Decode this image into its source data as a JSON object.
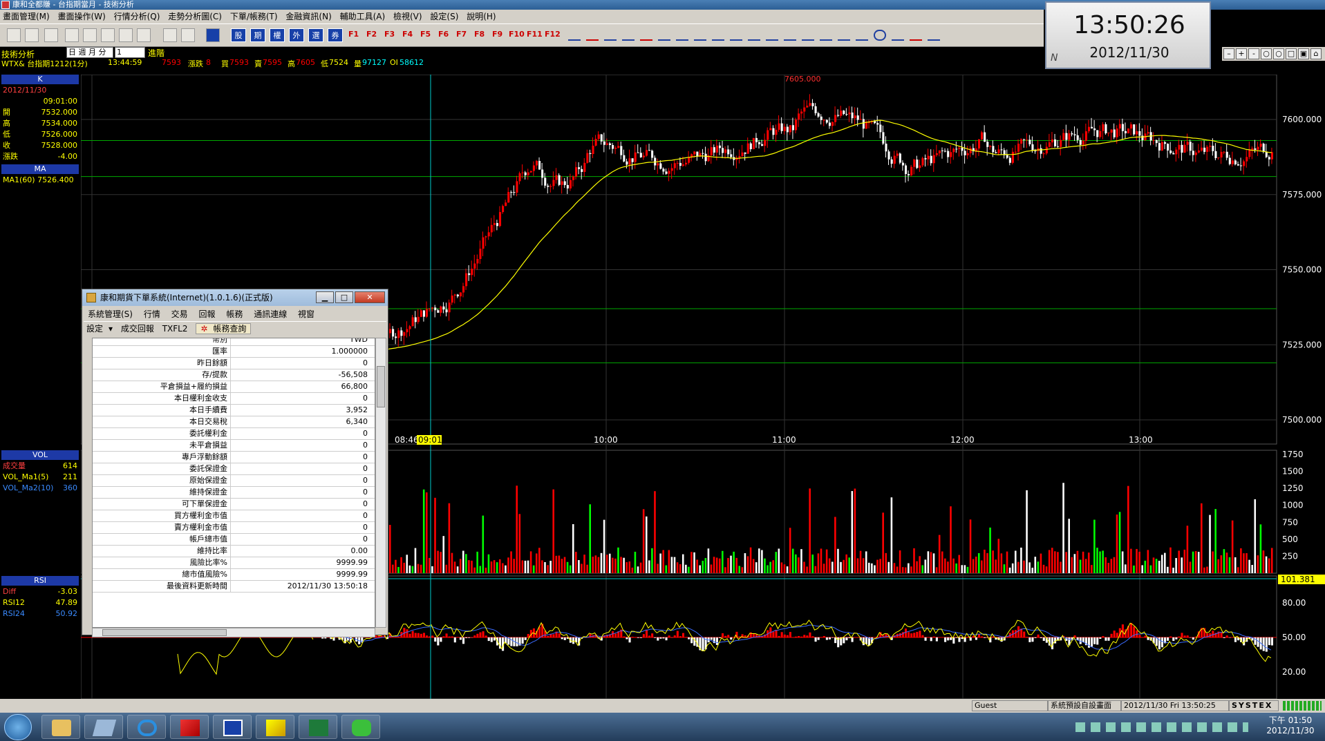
{
  "window": {
    "title": "康和全都賺 - 台指期當月 - 技術分析"
  },
  "menu": {
    "items": [
      "畫面管理(M)",
      "畫面操作(W)",
      "行情分析(Q)",
      "走勢分析圖(C)",
      "下單/帳務(T)",
      "金融資訊(N)",
      "輔助工具(A)",
      "檢視(V)",
      "設定(S)",
      "說明(H)"
    ]
  },
  "toolbar": {
    "red_buttons": [
      "股",
      "期",
      "權",
      "外",
      "選",
      "券"
    ],
    "fkeys": [
      "F1",
      "F2",
      "F3",
      "F4",
      "F5",
      "F6",
      "F7",
      "F8",
      "F9",
      "F10",
      "F11",
      "F12"
    ]
  },
  "clock": {
    "time": "13:50:26",
    "date": "2012/11/30",
    "badge": "N"
  },
  "info": {
    "title": "技術分析",
    "freq_label": "日 週 月 分",
    "freq_value": "1",
    "advance": "進階",
    "symbol": "WTX& 台指期1212(1分)",
    "time": "13:44:59",
    "last": "7593",
    "change_label": "漲跌",
    "change": "8",
    "bid_label": "買",
    "bid": "7593",
    "ask_label": "賣",
    "ask": "7595",
    "high_label": "高",
    "high": "7605",
    "low_label": "低",
    "low": "7524",
    "vol_label": "量",
    "vol": "97127",
    "oi_label": "OI",
    "oi": "58612"
  },
  "leftpanel": {
    "k_header": "K",
    "date": "2012/11/30",
    "time": "09:01:00",
    "rows": [
      {
        "k": "開",
        "v": "7532.000"
      },
      {
        "k": "高",
        "v": "7534.000"
      },
      {
        "k": "低",
        "v": "7526.000"
      },
      {
        "k": "收",
        "v": "7528.000"
      },
      {
        "k": "漲跌",
        "v": "-4.00"
      }
    ],
    "ma_header": "MA",
    "ma_row": "MA1(60) 7526.400",
    "vol_header": "VOL",
    "vol_rows": [
      {
        "k": "成交量",
        "v": "614"
      },
      {
        "k": "VOL_Ma1(5)",
        "v": "211"
      },
      {
        "k": "VOL_Ma2(10)",
        "v": "360"
      }
    ],
    "rsi_header": "RSI",
    "rsi_rows": [
      {
        "k": "Diff",
        "v": "-3.03"
      },
      {
        "k": "RSI12",
        "v": "47.89"
      },
      {
        "k": "RSI24",
        "v": "50.92"
      }
    ]
  },
  "chart": {
    "price_ticks": [
      "7600.000",
      "7575.000",
      "7550.000",
      "7525.000",
      "7500.000"
    ],
    "time_ticks": [
      "08:46",
      "09:01",
      "10:00",
      "11:00",
      "12:00",
      "13:00"
    ],
    "high_label": "7605.000",
    "vol_ticks": [
      "1750",
      "1500",
      "1250",
      "1000",
      "750",
      "500",
      "250"
    ],
    "rsi_ticks": [
      "80.00",
      "50.00",
      "20.00"
    ],
    "rsi_marker": "101.381",
    "colors": {
      "up": "#ff0000",
      "down": "#ffffff",
      "flat": "#00ff00",
      "ma": "#ffff00",
      "grid": "#00aa00",
      "cursor": "#00cccc",
      "rsi12": "#ffff00",
      "rsi24": "#3a6bff"
    }
  },
  "dialog": {
    "title": "康和期貨下單系統(Internet)(1.0.1.6)(正式版)",
    "menu": [
      "系統管理(S)",
      "行情",
      "交易",
      "回報",
      "帳務",
      "通訊連線",
      "視窗"
    ],
    "tools": [
      "設定",
      "成交回報",
      "TXFL2",
      "帳務查詢"
    ],
    "rows": [
      {
        "k": "幣別",
        "v": "TWD"
      },
      {
        "k": "匯率",
        "v": "1.000000"
      },
      {
        "k": "昨日餘額",
        "v": "0"
      },
      {
        "k": "存/提款",
        "v": "-56,508"
      },
      {
        "k": "平倉損益+履約損益",
        "v": "66,800"
      },
      {
        "k": "本日權利金收支",
        "v": "0"
      },
      {
        "k": "本日手續費",
        "v": "3,952"
      },
      {
        "k": "本日交易稅",
        "v": "6,340"
      },
      {
        "k": "委託權利金",
        "v": "0"
      },
      {
        "k": "未平倉損益",
        "v": "0"
      },
      {
        "k": "專戶浮動餘額",
        "v": "0"
      },
      {
        "k": "委託保證金",
        "v": "0"
      },
      {
        "k": "原始保證金",
        "v": "0"
      },
      {
        "k": "維持保證金",
        "v": "0"
      },
      {
        "k": "可下單保證金",
        "v": "0"
      },
      {
        "k": "買方權利金市值",
        "v": "0"
      },
      {
        "k": "賣方權利金市值",
        "v": "0"
      },
      {
        "k": "帳戶總市值",
        "v": "0"
      },
      {
        "k": "維持比率",
        "v": "0.00"
      },
      {
        "k": "風險比率%",
        "v": "9999.99"
      },
      {
        "k": "總市值風險%",
        "v": "9999.99"
      },
      {
        "k": "最後資料更新時間",
        "v": "2012/11/30 13:50:18"
      }
    ]
  },
  "statusbar": {
    "user": "Guest",
    "layout": "系統預設自設畫面",
    "datetime": "2012/11/30 Fri 13:50:25",
    "brand": "SYSTEX"
  },
  "taskbar": {
    "clock_time": "下午 01:50",
    "clock_date": "2012/11/30"
  }
}
